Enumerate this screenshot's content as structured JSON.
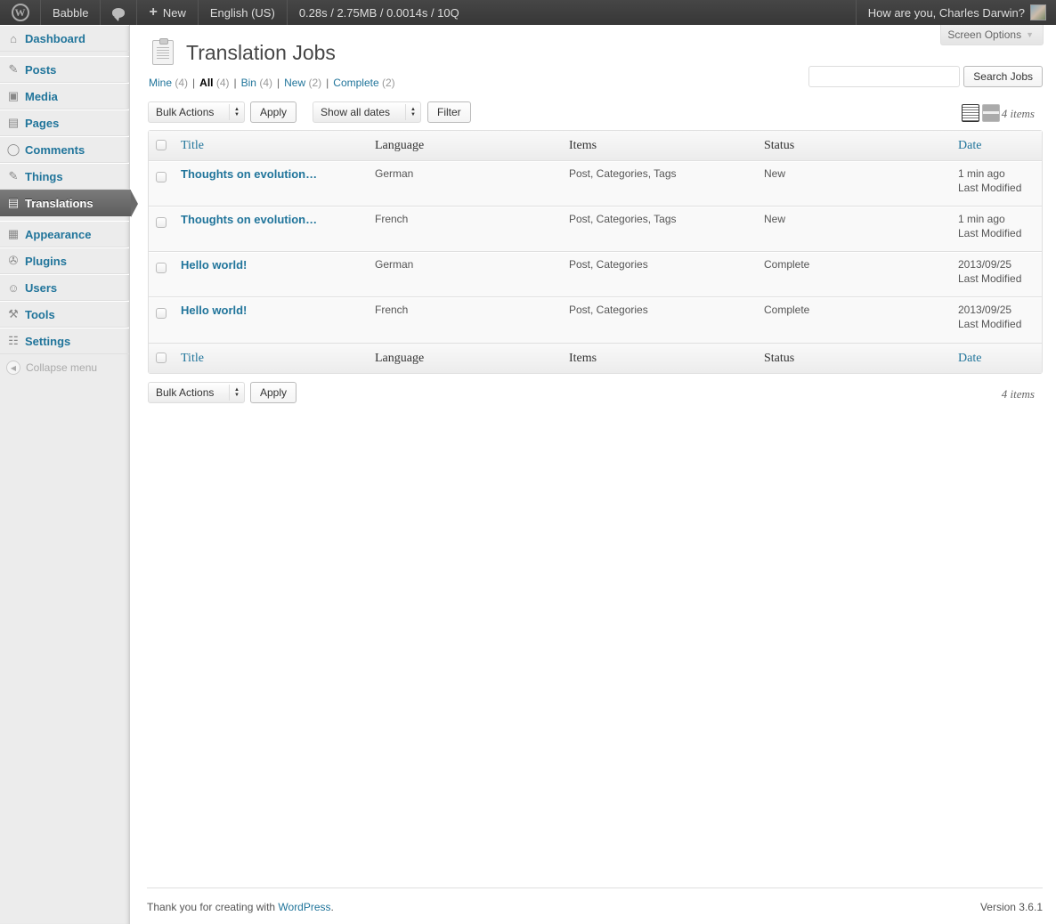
{
  "adminbar": {
    "logo_icon": "wordpress-logo-icon",
    "site_name": "Babble",
    "comments_icon": "comment-bubble-icon",
    "new_label": "New",
    "language": "English (US)",
    "debug_stats": "0.28s / 2.75MB / 0.0014s / 10Q",
    "greeting": "How are you, Charles Darwin?",
    "avatar_icon": "user-avatar-icon"
  },
  "sidebar": {
    "items": [
      {
        "label": "Dashboard",
        "icon": "house-icon",
        "glyph": "⌂"
      },
      {
        "label": "Posts",
        "icon": "pushpin-icon",
        "glyph": "✎"
      },
      {
        "label": "Media",
        "icon": "media-icon",
        "glyph": "▣"
      },
      {
        "label": "Pages",
        "icon": "pages-icon",
        "glyph": "▤"
      },
      {
        "label": "Comments",
        "icon": "comment-icon",
        "glyph": "◯"
      },
      {
        "label": "Things",
        "icon": "pushpin-icon",
        "glyph": "✎"
      },
      {
        "label": "Translations",
        "icon": "clipboard-icon",
        "glyph": "▤",
        "current": true
      },
      {
        "label": "Appearance",
        "icon": "appearance-icon",
        "glyph": "▦"
      },
      {
        "label": "Plugins",
        "icon": "plug-icon",
        "glyph": "✇"
      },
      {
        "label": "Users",
        "icon": "users-icon",
        "glyph": "☺"
      },
      {
        "label": "Tools",
        "icon": "tools-icon",
        "glyph": "⚒"
      },
      {
        "label": "Settings",
        "icon": "settings-icon",
        "glyph": "☷"
      }
    ],
    "collapse_label": "Collapse menu"
  },
  "screen_options": {
    "label": "Screen Options"
  },
  "page": {
    "title": "Translation Jobs"
  },
  "filters": [
    {
      "label": "Mine",
      "count": "(4)",
      "current": false
    },
    {
      "label": "All",
      "count": "(4)",
      "current": true
    },
    {
      "label": "Bin",
      "count": "(4)",
      "current": false
    },
    {
      "label": "New",
      "count": "(2)",
      "current": false
    },
    {
      "label": "Complete",
      "count": "(2)",
      "current": false
    }
  ],
  "search": {
    "value": "",
    "placeholder": "",
    "button": "Search Jobs"
  },
  "tablenav_top": {
    "bulk_actions": "Bulk Actions",
    "apply": "Apply",
    "dates": "Show all dates",
    "filter": "Filter",
    "count": "4 items"
  },
  "tablenav_bottom": {
    "bulk_actions": "Bulk Actions",
    "apply": "Apply",
    "count": "4 items"
  },
  "table": {
    "columns": {
      "title": "Title",
      "language": "Language",
      "items": "Items",
      "status": "Status",
      "date": "Date"
    },
    "rows": [
      {
        "title": "Thoughts on evolution…",
        "language": "German",
        "items": "Post, Categories, Tags",
        "status": "New",
        "date": "1 min ago",
        "date_label": "Last Modified"
      },
      {
        "title": "Thoughts on evolution…",
        "language": "French",
        "items": "Post, Categories, Tags",
        "status": "New",
        "date": "1 min ago",
        "date_label": "Last Modified"
      },
      {
        "title": "Hello world!",
        "language": "German",
        "items": "Post, Categories",
        "status": "Complete",
        "date": "2013/09/25",
        "date_label": "Last Modified"
      },
      {
        "title": "Hello world!",
        "language": "French",
        "items": "Post, Categories",
        "status": "Complete",
        "date": "2013/09/25",
        "date_label": "Last Modified"
      }
    ]
  },
  "footer": {
    "thanks_prefix": "Thank you for creating with ",
    "wp_link": "WordPress",
    "thanks_suffix": ".",
    "version": "Version 3.6.1"
  }
}
